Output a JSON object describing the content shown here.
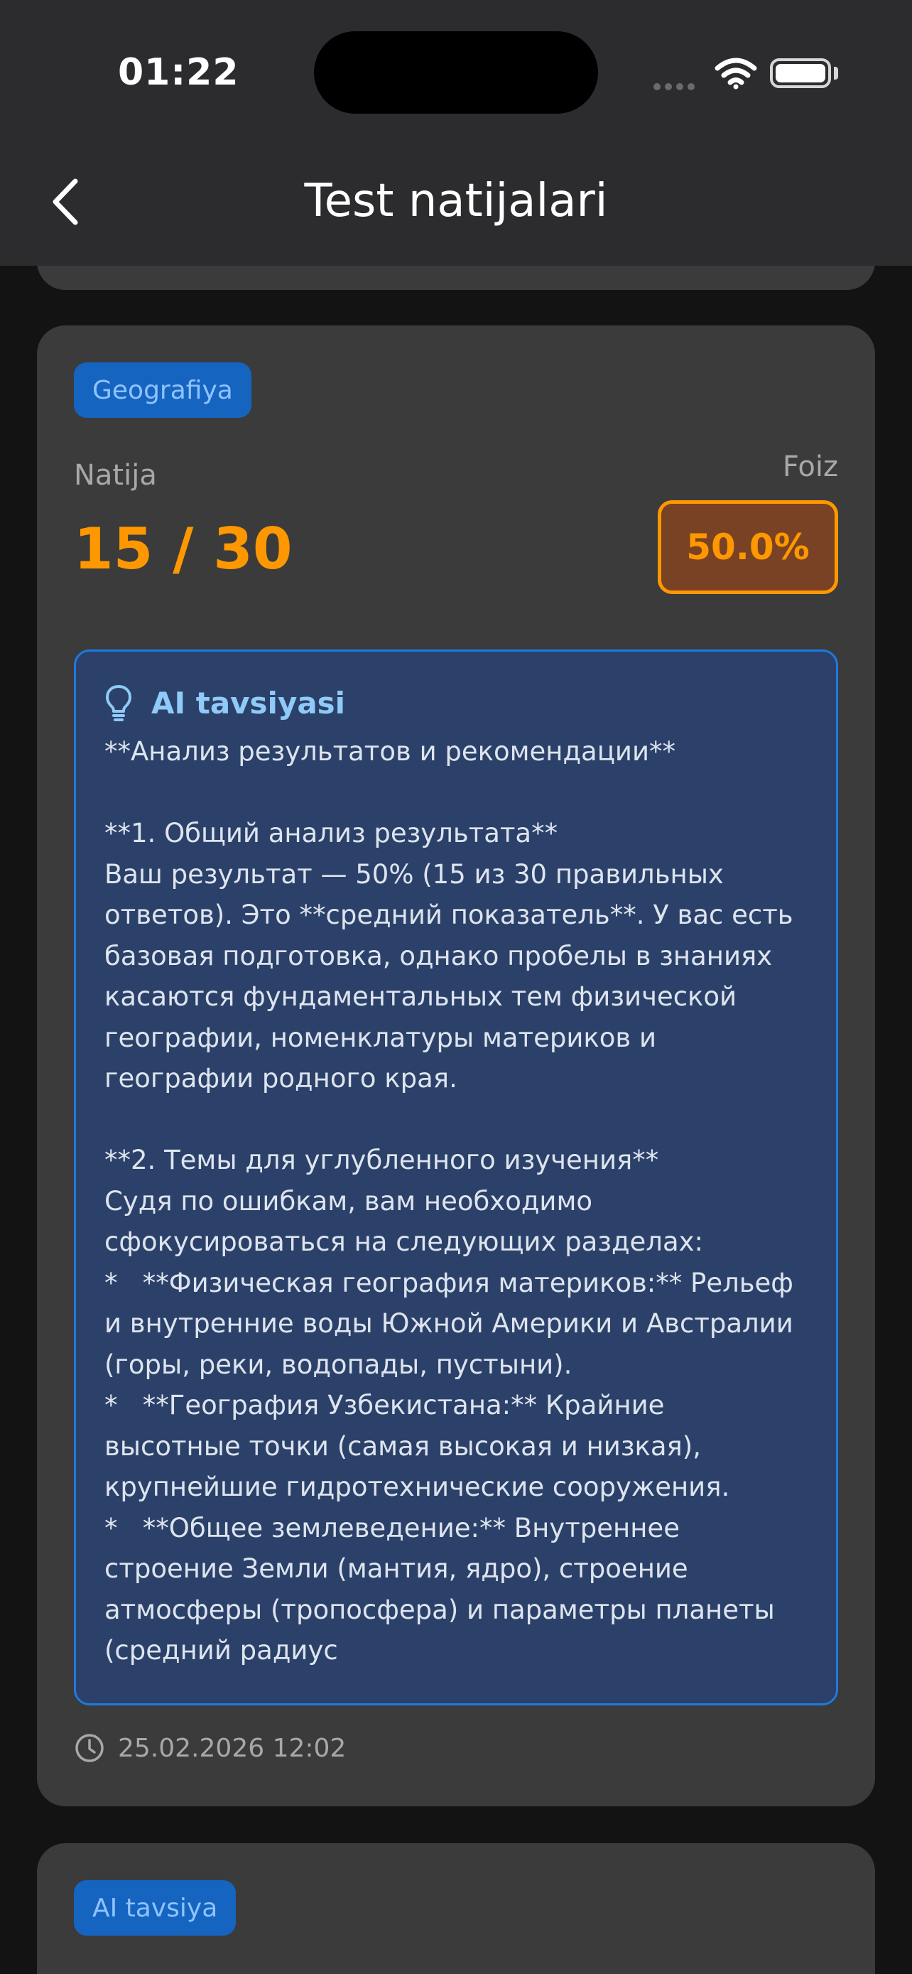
{
  "status_bar": {
    "time": "01:22"
  },
  "header": {
    "title": "Test natijalari"
  },
  "result_card": {
    "subject": "Geografiya",
    "result_label": "Natija",
    "score": "15 / 30",
    "percent_label": "Foiz",
    "percent": "50.0%",
    "ai": {
      "title": "AI tavsiyasi",
      "text": "**Анализ результатов и рекомендации**\n\n**1. Общий анализ результата**\nВаш результат — 50% (15 из 30 правильных ответов). Это **средний показатель**. У вас есть базовая подготовка, однако пробелы в знаниях касаются фундаментальных тем физической географии, номенклатуры материков и географии родного края.\n\n**2. Темы для углубленного изучения**\nСудя по ошибкам, вам необходимо сфокусироваться на следующих разделах:\n*   **Физическая география материков:** Рельеф и внутренние воды Южной Америки и Австралии (горы, реки, водопады, пустыни).\n*   **География Узбекистана:** Крайние высотные точки (самая высокая и низкая), крупнейшие гидротехнические сооружения.\n*   **Общее землеведение:** Внутреннее строение Земли (мантия, ядро), строение атмосферы (тропосфера) и параметры планеты (средний радиус"
    },
    "date": "25.02.2026 12:02"
  },
  "next_card": {
    "chip": "AI tavsiya"
  },
  "colors": {
    "accent_orange": "#ff9800",
    "chip_blue": "#1565c0",
    "ai_box_bg": "#2c4169",
    "card_bg": "#3b3b3c"
  }
}
